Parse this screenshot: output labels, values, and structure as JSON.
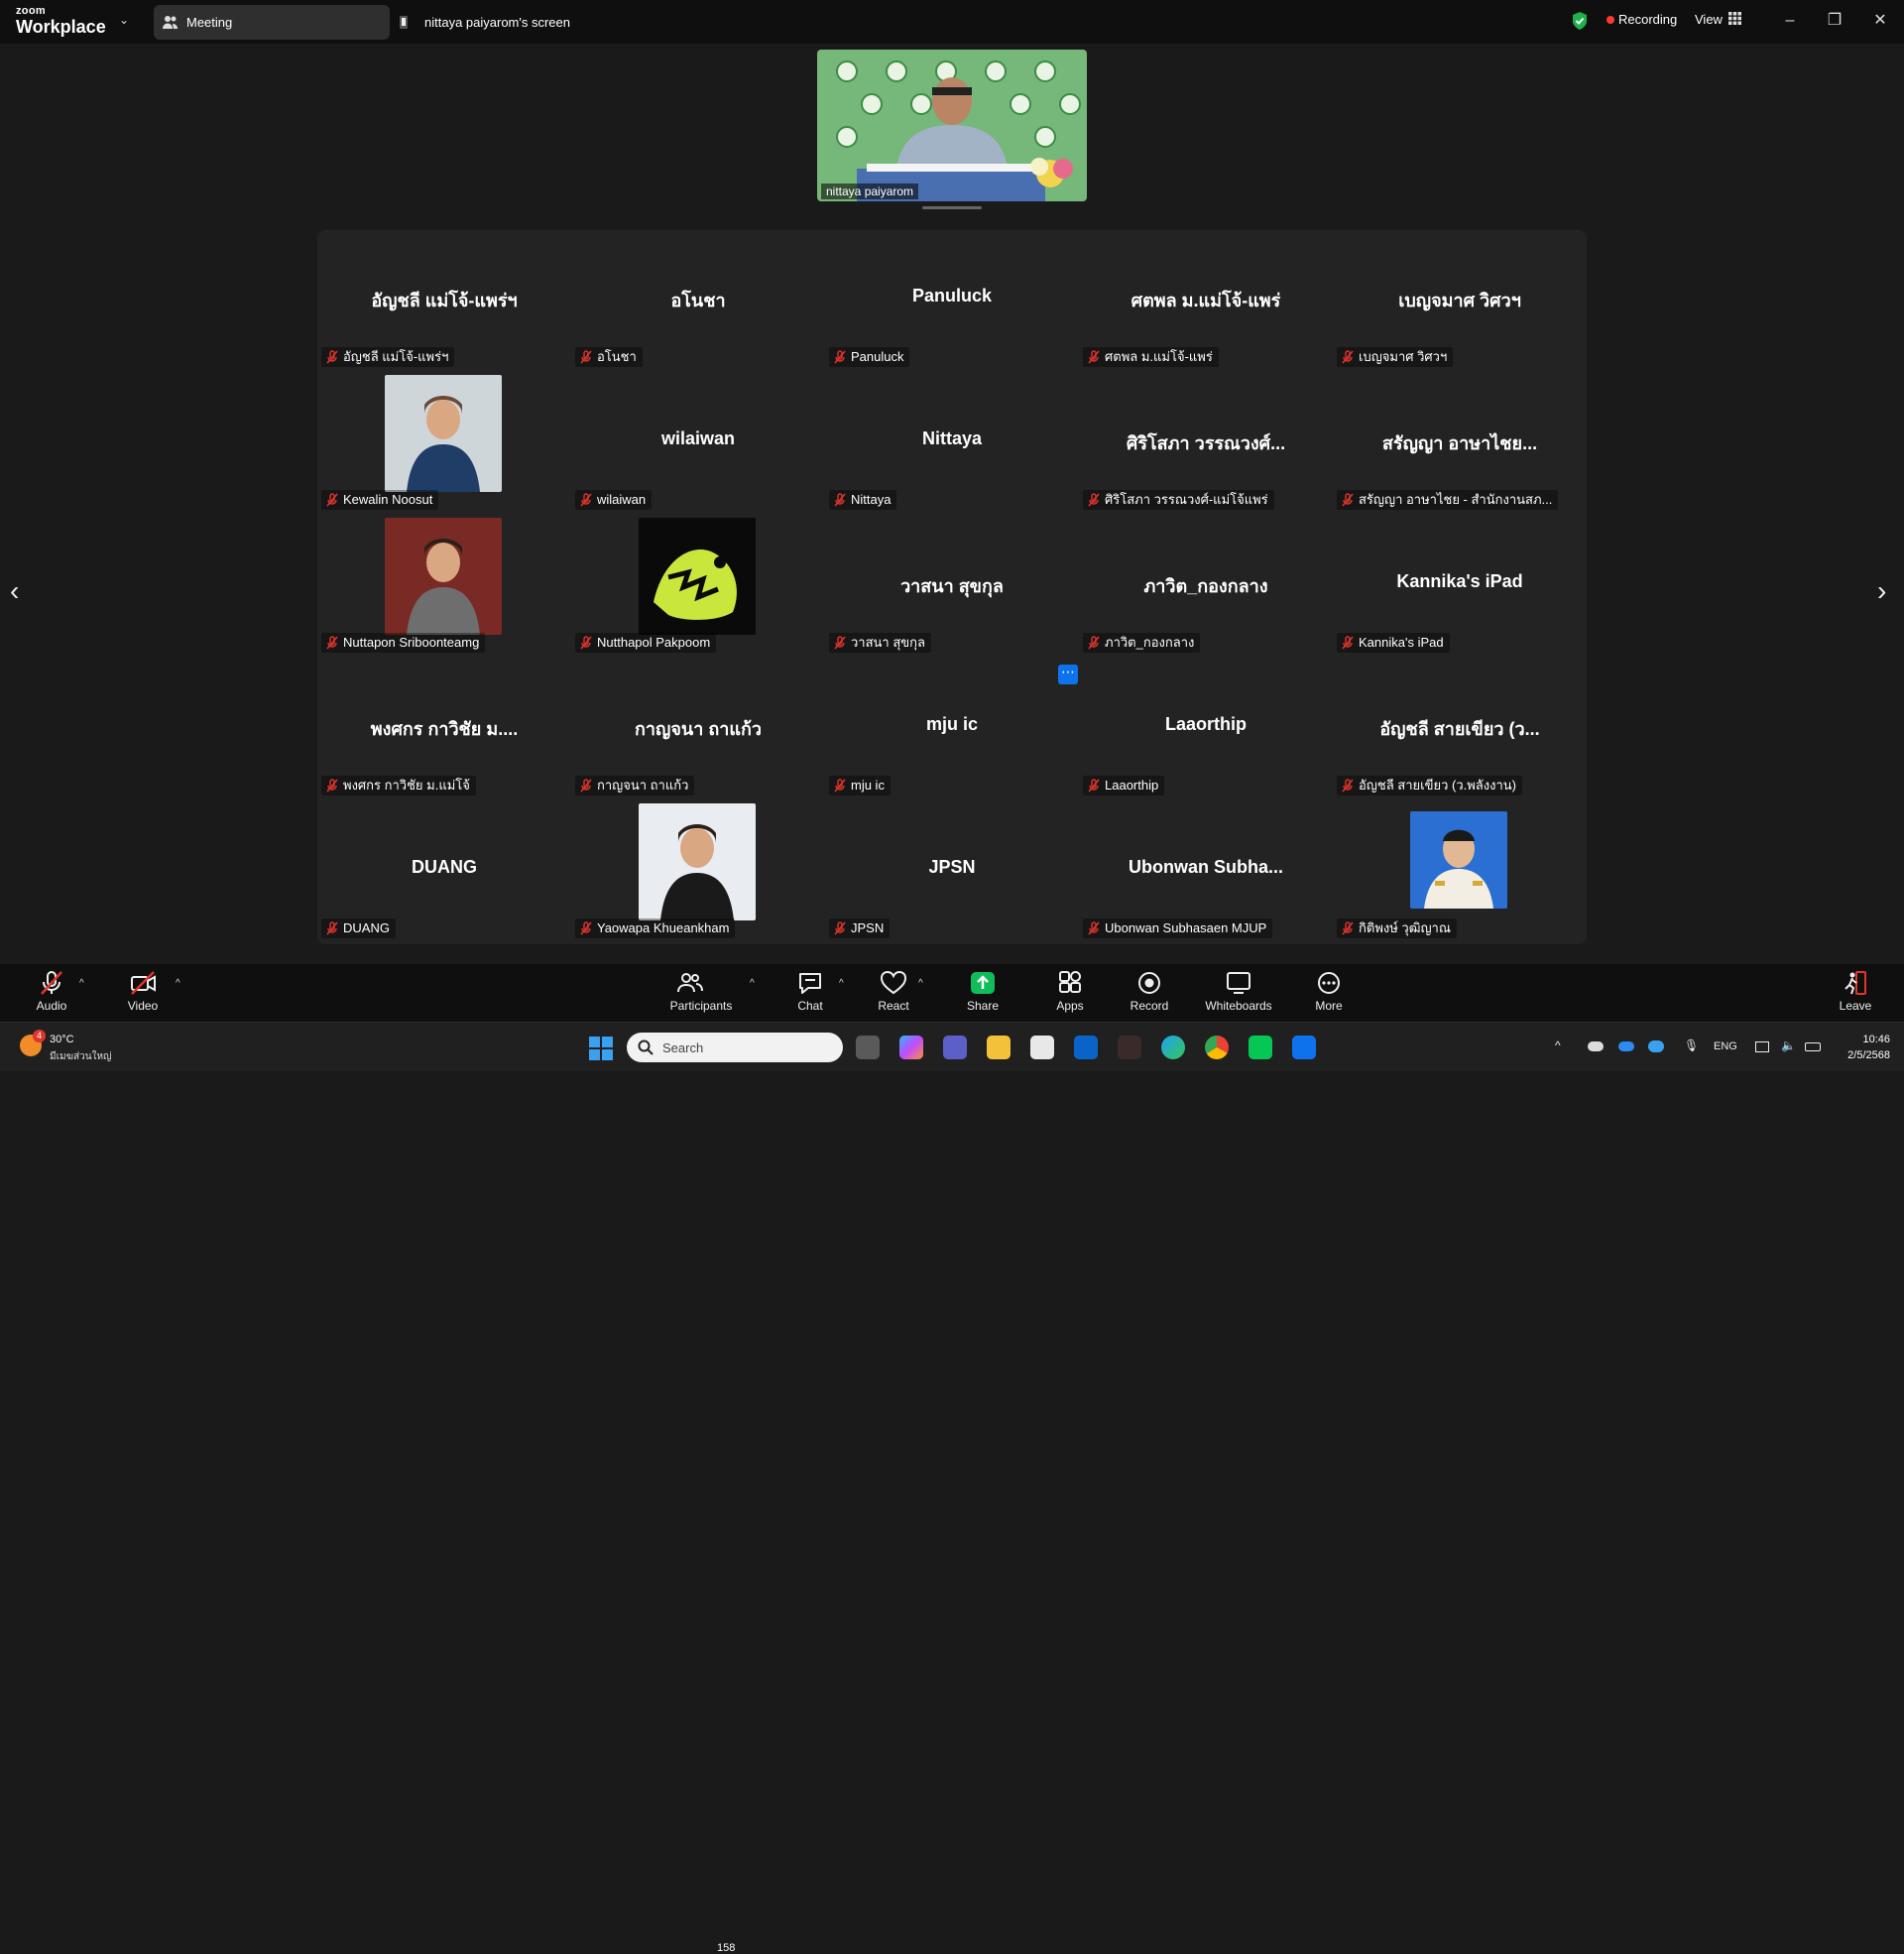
{
  "titlebar": {
    "brand_top": "zoom",
    "brand_bottom": "Workplace",
    "tab_meeting": "Meeting",
    "tab_screen": "nittaya paiyarom's screen",
    "recording": "Recording",
    "view": "View"
  },
  "speaker": {
    "name": "nittaya paiyarom"
  },
  "gallery": {
    "tiles": [
      {
        "big": "อัญชลี แม่โจ้-แพร่ฯ",
        "name": "อัญชลี แม่โจ้-แพร่ฯ"
      },
      {
        "big": "อโนชา",
        "name": "อโนชา"
      },
      {
        "big": "Panuluck",
        "name": "Panuluck"
      },
      {
        "big": "ศตพล ม.แม่โจ้-แพร่",
        "name": "ศตพล ม.แม่โจ้-แพร่"
      },
      {
        "big": "เบญจมาศ วิศวฯ",
        "name": "เบญจมาศ วิศวฯ"
      },
      {
        "big": "",
        "name": "Kewalin Noosut"
      },
      {
        "big": "wilaiwan",
        "name": "wilaiwan"
      },
      {
        "big": "Nittaya",
        "name": "Nittaya"
      },
      {
        "big": "ศิริโสภา วรรณวงศ์...",
        "name": "ศิริโสภา วรรณวงศ์-แม่โจ้แพร่"
      },
      {
        "big": "สรัญญา อาษาไชย...",
        "name": "สรัญญา อาษาไชย - สำนักงานสภ..."
      },
      {
        "big": "",
        "name": "Nuttapon Sriboonteamg"
      },
      {
        "big": "",
        "name": "Nutthapol Pakpoom"
      },
      {
        "big": "วาสนา สุขกุล",
        "name": "วาสนา สุขกุล"
      },
      {
        "big": "ภาวิต_กองกลาง",
        "name": "ภาวิต_กองกลาง"
      },
      {
        "big": "Kannika's iPad",
        "name": "Kannika's iPad"
      },
      {
        "big": "พงศกร กาวิชัย ม....",
        "name": "พงศกร กาวิชัย ม.แม่โจ้"
      },
      {
        "big": "กาญจนา ถาแก้ว",
        "name": "กาญจนา ถาแก้ว"
      },
      {
        "big": "mju ic",
        "name": "mju ic"
      },
      {
        "big": "Laaorthip",
        "name": "Laaorthip"
      },
      {
        "big": "อัญชลี สายเขียว (ว...",
        "name": "อัญชลี สายเขียว (ว.พลังงาน)"
      },
      {
        "big": "DUANG",
        "name": "DUANG"
      },
      {
        "big": "",
        "name": "Yaowapa Khueankham"
      },
      {
        "big": "JPSN",
        "name": "JPSN"
      },
      {
        "big": "Ubonwan  Subha...",
        "name": "Ubonwan Subhasaen MJUP"
      },
      {
        "big": "",
        "name": "กิติพงษ์ วุฒิญาณ"
      }
    ]
  },
  "toolbar": {
    "audio": "Audio",
    "video": "Video",
    "participants": "Participants",
    "participants_count": "158",
    "chat": "Chat",
    "react": "React",
    "share": "Share",
    "apps": "Apps",
    "record": "Record",
    "whiteboards": "Whiteboards",
    "more": "More",
    "leave": "Leave"
  },
  "taskbar": {
    "weather_badge": "4",
    "weather_temp": "30°C",
    "weather_desc": "มีเมฆส่วนใหญ่",
    "search_placeholder": "Search",
    "lang": "ENG",
    "time": "10:46",
    "date": "2/5/2568"
  },
  "colors": {
    "accent_blue": "#0e72ed",
    "share_green": "#0fbd5b",
    "mute_red": "#e0342c",
    "recording_red": "#ff3b30",
    "shield_green": "#1fb14a"
  }
}
